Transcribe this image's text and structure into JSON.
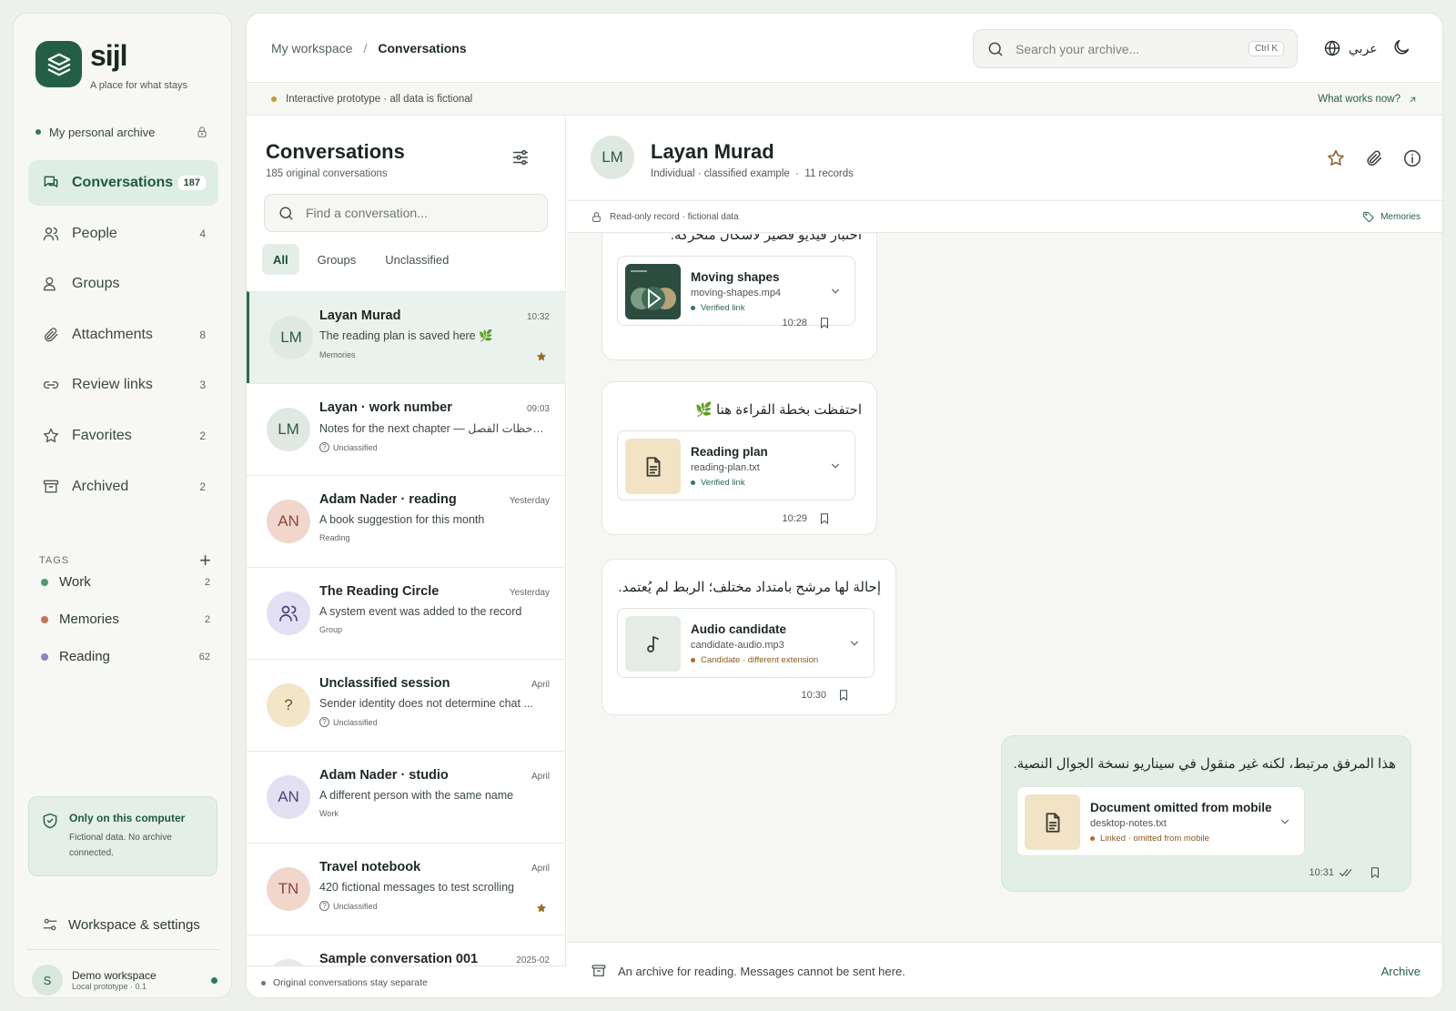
{
  "brand": {
    "name": "sijl",
    "tagline": "A place for what stays"
  },
  "archive_selector": {
    "label": "My personal archive"
  },
  "nav": [
    {
      "label": "Conversations",
      "count": "187",
      "icon": "chat-icon",
      "active": true
    },
    {
      "label": "People",
      "count": "4",
      "icon": "people-icon"
    },
    {
      "label": "Groups",
      "count": "",
      "icon": "group-icon"
    },
    {
      "label": "Attachments",
      "count": "8",
      "icon": "paperclip-icon"
    },
    {
      "label": "Review links",
      "count": "3",
      "icon": "link-icon"
    },
    {
      "label": "Favorites",
      "count": "2",
      "icon": "star-icon"
    },
    {
      "label": "Archived",
      "count": "2",
      "icon": "archive-icon"
    }
  ],
  "tags": {
    "heading": "TAGS",
    "items": [
      {
        "label": "Work",
        "count": "2",
        "color": "#4e9a6e"
      },
      {
        "label": "Memories",
        "count": "2",
        "color": "#c7735b"
      },
      {
        "label": "Reading",
        "count": "62",
        "color": "#8d83c6"
      }
    ]
  },
  "local_card": {
    "title": "Only on this computer",
    "desc": "Fictional data. No archive connected."
  },
  "settings": {
    "label": "Workspace & settings"
  },
  "user": {
    "initial": "S",
    "name": "Demo workspace",
    "sub": "Local prototype · 0.1"
  },
  "breadcrumb": {
    "root": "My workspace",
    "sep": "/",
    "current": "Conversations"
  },
  "search": {
    "placeholder": "Search your archive...",
    "shortcut": "Ctrl K"
  },
  "language": {
    "label": "عربي"
  },
  "banner": {
    "text": "Interactive prototype · all data is fictional",
    "link": "What works now?"
  },
  "list": {
    "title": "Conversations",
    "subtitle": "185 original conversations",
    "find_placeholder": "Find a conversation...",
    "tabs": [
      "All",
      "Groups",
      "Unclassified"
    ],
    "rows": [
      {
        "initials": "LM",
        "name": "Layan Murad",
        "time": "10:32",
        "preview": "The reading plan is saved here 🌿",
        "tag": "Memories",
        "avatar_bg": "#dfe9e2",
        "avatar_fg": "#2d5a44",
        "starred": true,
        "active": true
      },
      {
        "initials": "LM",
        "name": "Layan · work number",
        "time": "09:03",
        "preview": "Notes for the next chapter — ملاحظات الفصل...",
        "tag": "Unclassified",
        "avatar_bg": "#dfe9e2",
        "avatar_fg": "#2d5a44",
        "unclassified": true
      },
      {
        "initials": "AN",
        "name": "Adam Nader · reading",
        "time": "Yesterday",
        "preview": "A book suggestion for this month",
        "tag": "Reading",
        "avatar_bg": "#f1d6cc",
        "avatar_fg": "#8a4a38"
      },
      {
        "initials": "",
        "name": "The Reading Circle",
        "time": "Yesterday",
        "preview": "A system event was added to the record",
        "tag": "Group",
        "avatar_bg": "#e4e0f3",
        "avatar_fg": "#4a4380",
        "group": true
      },
      {
        "initials": "?",
        "name": "Unclassified session",
        "time": "April",
        "preview": "Sender identity does not determine chat ...",
        "tag": "Unclassified",
        "avatar_bg": "#f3e5c8",
        "avatar_fg": "#6a5120",
        "unclassified": true
      },
      {
        "initials": "AN",
        "name": "Adam Nader · studio",
        "time": "April",
        "preview": "A different person with the same name",
        "tag": "Work",
        "avatar_bg": "#e4e0f3",
        "avatar_fg": "#4a4380"
      },
      {
        "initials": "TN",
        "name": "Travel notebook",
        "time": "April",
        "preview": "420 fictional messages to test scrolling",
        "tag": "Unclassified",
        "avatar_bg": "#f1d6cc",
        "avatar_fg": "#8a4a38",
        "unclassified": true,
        "starred": true
      },
      {
        "initials": "",
        "name": "Sample conversation 001",
        "time": "2025-02",
        "preview": "",
        "tag": "",
        "avatar_bg": "#e6ebe6",
        "avatar_fg": "#2d5a44"
      }
    ],
    "footer": "Original conversations stay separate"
  },
  "thread": {
    "initials": "LM",
    "name": "Layan Murad",
    "type": "Individual · classified example",
    "dot": "·",
    "records": "11 records",
    "readonly": "Read-only record · fictional data",
    "tag": "Memories",
    "messages": [
      {
        "text": "اختبار فيديو قصير لأشكال متحركة.",
        "att_name": "Moving shapes",
        "att_file": "moving-shapes.mp4",
        "att_status": "Verified link",
        "time": "10:28"
      },
      {
        "text": "احتفظت بخطة القراءة هنا 🌿",
        "att_name": "Reading plan",
        "att_file": "reading-plan.txt",
        "att_status": "Verified link",
        "time": "10:29"
      },
      {
        "text": "إحالة لها مرشح بامتداد مختلف؛ الربط لم يُعتمد.",
        "att_name": "Audio candidate",
        "att_file": "candidate-audio.mp3",
        "att_status": "Candidate · different extension",
        "time": "10:30"
      },
      {
        "text": "هذا المرفق مرتبط، لكنه غير منقول في سيناريو نسخة الجوال النصية.",
        "att_name": "Document omitted from mobile",
        "att_file": "desktop-notes.txt",
        "att_status": "Linked · omitted from mobile",
        "time": "10:31"
      }
    ],
    "footer": "An archive for reading. Messages cannot be sent here.",
    "footer_action": "Archive"
  },
  "colors": {
    "accent": "#255e47",
    "active_bg": "#dfeee5",
    "outgoing_bubble": "#e2efe7",
    "star": "#8a5f26"
  }
}
